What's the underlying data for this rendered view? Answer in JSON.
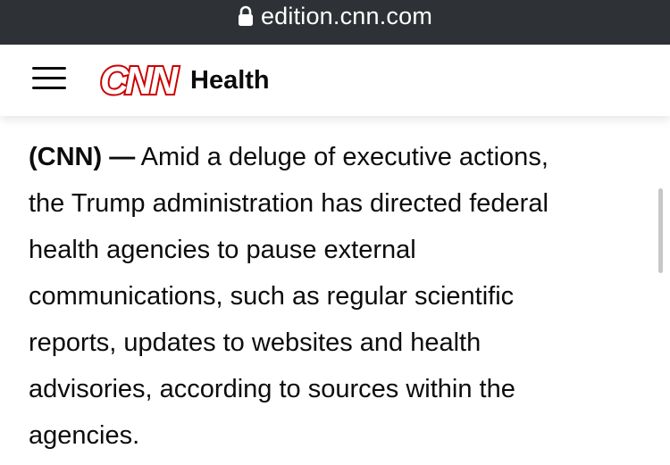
{
  "browser": {
    "url": "edition.cnn.com",
    "lock_icon": "lock-icon"
  },
  "header": {
    "menu_icon": "hamburger-menu-icon",
    "logo_text": "CNN",
    "logo_color": "#cc0000",
    "section": "Health"
  },
  "article": {
    "dateline": "(CNN) —",
    "lines": [
      " Amid a deluge of executive actions,",
      "the Trump administration has directed federal",
      "health agencies to pause external",
      "communications, such as regular scientific",
      "reports, updates to websites and health",
      "advisories, according to sources within the",
      "agencies."
    ]
  }
}
